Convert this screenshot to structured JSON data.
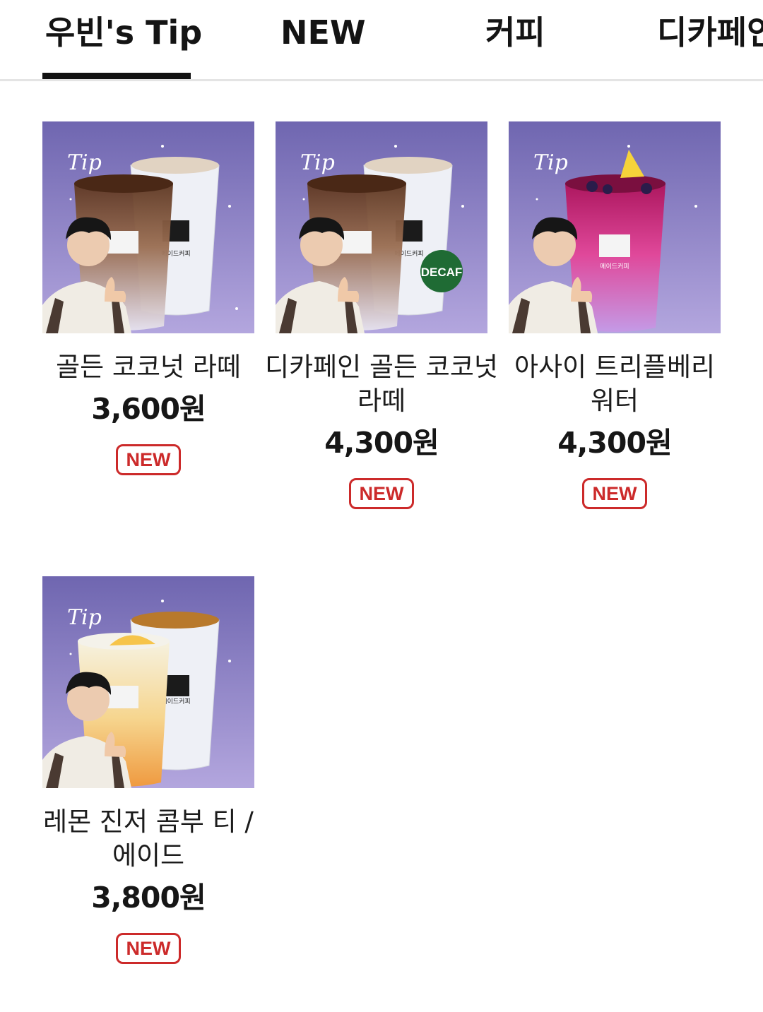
{
  "tabs": [
    {
      "label": "우빈's Tip",
      "selected": true
    },
    {
      "label": "NEW",
      "selected": false
    },
    {
      "label": "커피",
      "selected": false
    },
    {
      "label": "디카페인",
      "selected": false
    }
  ],
  "products": [
    {
      "name": "골든 코코넛 라떼",
      "price": "3,600원",
      "badge": "NEW",
      "image_tip": "Tip",
      "cup_logo": "메이드커피"
    },
    {
      "name": "디카페인 골든 코코넛 라떼",
      "price": "4,300원",
      "badge": "NEW",
      "image_tip": "Tip",
      "cup_logo": "메이드커피",
      "image_badge": "DECAF"
    },
    {
      "name": "아사이 트리플베리 워터",
      "price": "4,300원",
      "badge": "NEW",
      "image_tip": "Tip",
      "cup_logo": "메이드커피"
    },
    {
      "name": "레몬 진저 콤부 티 / 에이드",
      "price": "3,800원",
      "badge": "NEW",
      "image_tip": "Tip",
      "cup_logo": "메이드커피"
    }
  ],
  "colors": {
    "badge_red": "#cc2a2a",
    "tab_underline": "#111111",
    "image_bg": "#8b80c4",
    "decaf_green": "#1f6b34"
  }
}
